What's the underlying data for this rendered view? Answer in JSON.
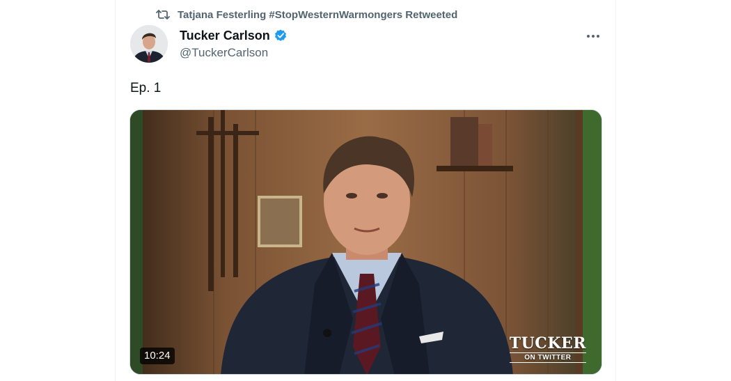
{
  "retweet": {
    "text": "Tatjana Festerling #StopWesternWarmongers Retweeted",
    "icon": "retweet-icon"
  },
  "author": {
    "name": "Tucker Carlson",
    "handle": "@TuckerCarlson",
    "verified": true,
    "verified_color": "#1d9bf0"
  },
  "tweet": {
    "text": "Ep. 1"
  },
  "media": {
    "duration": "10:24",
    "watermark_main": "TUCKER",
    "watermark_sub": "ON TWITTER"
  },
  "colors": {
    "text_primary": "#0f1419",
    "text_secondary": "#536471",
    "border": "#eff3f4"
  }
}
